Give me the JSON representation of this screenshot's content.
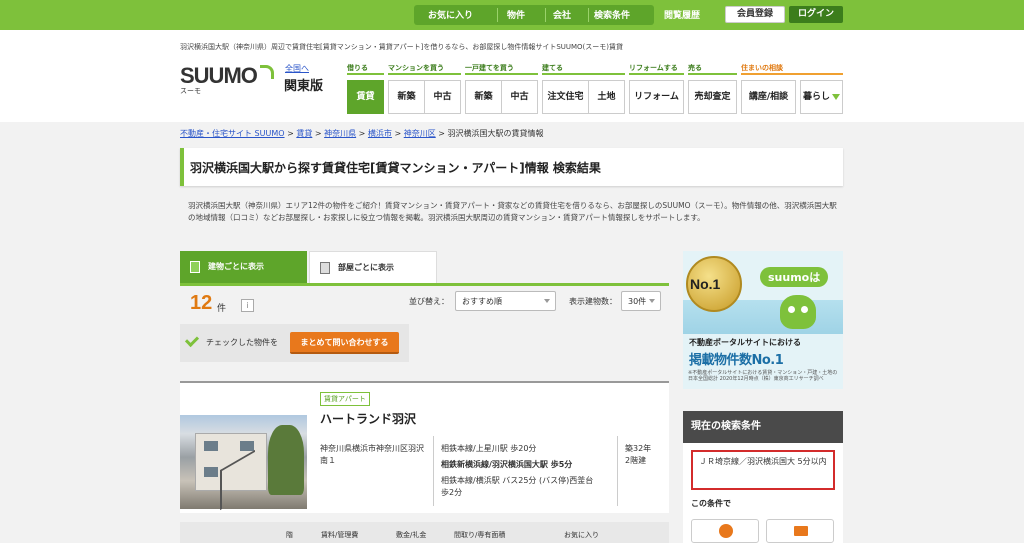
{
  "topbar": {
    "favorites": "お気に入り",
    "properties": "物件",
    "companies": "会社",
    "search_conditions": "検索条件",
    "history": "閲覧履歴",
    "register": "会員登録",
    "login": "ログイン"
  },
  "header": {
    "site_desc": "羽沢横浜国大駅（神奈川県）周辺で賃貸住宅[賃貸マンション・賃貸アパート]を借りるなら、お部屋探し物件情報サイトSUUMO(スーモ)賃貸",
    "logo": "SUUMO",
    "logo_sub": "スーモ",
    "area_link": "全国へ",
    "area_name": "関東版",
    "nav_categories": {
      "rent": "借りる",
      "mansion": "マンションを買う",
      "house": "一戸建てを買う",
      "build": "建てる",
      "reform": "リフォームする",
      "sell": "売る",
      "consult": "住まいの相談"
    },
    "nav": {
      "rent": "賃貸",
      "mansion_new": "新築",
      "mansion_used": "中古",
      "house_new": "新築",
      "house_used": "中古",
      "custom_home": "注文住宅",
      "land": "土地",
      "reform": "リフォーム",
      "sale_assess": "売却査定",
      "seminar": "講座/相談",
      "living": "暮らし"
    }
  },
  "breadcrumb": {
    "home": "不動産・住宅サイト SUUMO",
    "rent": "賃貸",
    "pref": "神奈川県",
    "city": "横浜市",
    "ward": "神奈川区",
    "current": "羽沢横浜国大駅の賃貸情報",
    "sep": ">"
  },
  "page_title": "羽沢横浜国大駅から探す賃貸住宅[賃貸マンション・アパート]情報 検索結果",
  "intro": "羽沢横浜国大駅（神奈川県）エリア12件の物件をご紹介！賃貸マンション・賃貸アパート・貸家などの賃貸住宅を借りるなら、お部屋探しのSUUMO（スーモ）。物件情報の他、羽沢横浜国大駅の地域情報（口コミ）などお部屋探し・お家探しに役立つ情報を掲載。羽沢横浜国大駅周辺の賃貸マンション・賃貸アパート情報探しをサポートします。",
  "tabs": {
    "by_building": "建物ごとに表示",
    "by_room": "部屋ごとに表示"
  },
  "results": {
    "count": "12",
    "unit": "件",
    "info": "i",
    "sort_label": "並び替え：",
    "sort_value": "おすすめ順",
    "display_label": "表示建物数：",
    "display_value": "30件"
  },
  "bulk": {
    "text": "チェックした物件を",
    "button": "まとめて問い合わせする"
  },
  "listing": {
    "badge": "賃貸アパート",
    "name": "ハートランド羽沢",
    "address": "神奈川県横浜市神奈川区羽沢南１",
    "access1": "相鉄本線/上星川駅 歩20分",
    "access2": "相鉄新横浜線/羽沢横浜国大駅 歩5分",
    "access3_line1": "相鉄本線/横浜駅 バス25分 (バス停)西釜台",
    "access3_line2": "歩2分",
    "age": "築32年",
    "floors": "2階建"
  },
  "table_head": {
    "floor": "階",
    "rent": "賃料/管理費",
    "deposit": "敷金/礼金",
    "layout": "間取り/専有面積",
    "favorite": "お気に入り"
  },
  "ad": {
    "medal": "No.1",
    "brand": "suumoは",
    "line1": "不動産ポータルサイトにおける",
    "line2": "掲載物件数No.1",
    "note": "※不動産ポータルサイトにおける賃貸・マンション・戸建・土地の日本全国総計 2020年12月時点（株）東京商工リサーチ調べ"
  },
  "conditions": {
    "header": "現在の検索条件",
    "text": "ＪＲ埼京線／羽沢横浜国大 5分以内",
    "sub": "この条件で"
  }
}
